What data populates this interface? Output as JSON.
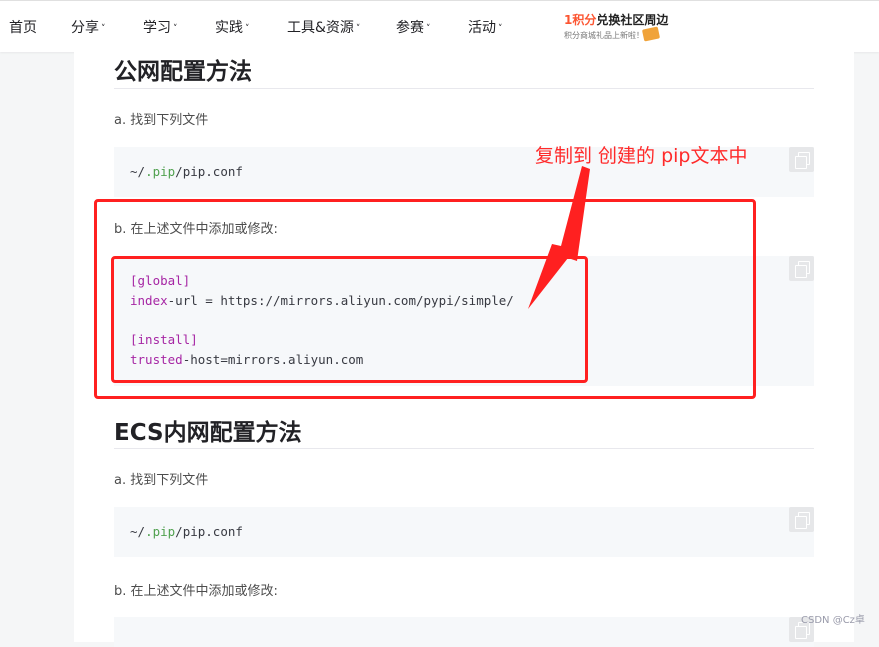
{
  "nav": {
    "items": [
      {
        "label": "首页",
        "has_dropdown": false
      },
      {
        "label": "分享",
        "has_dropdown": true
      },
      {
        "label": "学习",
        "has_dropdown": true
      },
      {
        "label": "实践",
        "has_dropdown": true
      },
      {
        "label": "工具&资源",
        "has_dropdown": true
      },
      {
        "label": "参赛",
        "has_dropdown": true
      },
      {
        "label": "活动",
        "has_dropdown": true
      }
    ],
    "dropdown_glyph": "˅",
    "promo": {
      "highlight": "1积分",
      "title": "兑换社区周边",
      "subtitle": "积分商城礼品上新啦！"
    }
  },
  "article": {
    "section1": {
      "heading": "公网配置方法",
      "step_a": "a. 找到下列文件",
      "file_path": {
        "tilde": "~/",
        "dir": ".pip",
        "slash": "/",
        "file": "pip.conf"
      },
      "step_b": "b. 在上述文件中添加或修改:",
      "config": {
        "global_section": "[global]",
        "index_key": "index",
        "index_rest": "-url = https://mirrors.aliyun.com/pypi/simple/",
        "install_section": "[install]",
        "trusted_key": "trusted",
        "trusted_rest": "-host=mirrors.aliyun.com"
      }
    },
    "section2": {
      "heading": "ECS内网配置方法",
      "step_a": "a. 找到下列文件",
      "file_path": {
        "tilde": "~/",
        "dir": ".pip",
        "slash": "/",
        "file": "pip.conf"
      },
      "step_b": "b. 在上述文件中添加或修改:"
    }
  },
  "annotation": {
    "text": "复制到 创建的 pip文本中",
    "color": "#ff2020"
  },
  "watermark": "CSDN @Cz卓",
  "colors": {
    "accent": "#fc5531",
    "code_bg": "#f6f8fa",
    "code_purple": "#a626a4",
    "code_green": "#50a14f"
  }
}
